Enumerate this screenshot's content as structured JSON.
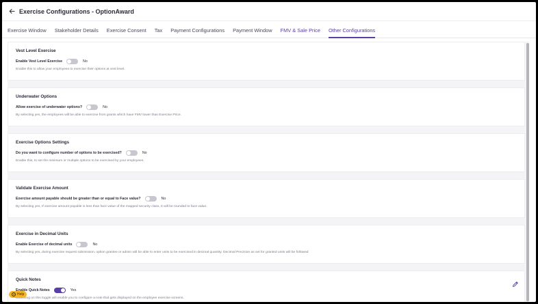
{
  "header": {
    "title": "Exercise Configurations - OptionAward"
  },
  "tabs": [
    {
      "label": "Exercise Window"
    },
    {
      "label": "Stakeholder Details"
    },
    {
      "label": "Exercise Consent"
    },
    {
      "label": "Tax"
    },
    {
      "label": "Payment Configurations"
    },
    {
      "label": "Payment Window"
    },
    {
      "label": "FMV & Sale Price"
    },
    {
      "label": "Other Configurations"
    }
  ],
  "active_tab": "Other Configurations",
  "sections": [
    {
      "title": "Vest Level Exercise",
      "label": "Enable Vest Level Exercise",
      "state": "No",
      "description": "Enable this to allow your employees to exercise their options at vest level."
    },
    {
      "title": "Underwater Options",
      "label": "Allow exercise of underwater options?",
      "state": "No",
      "description": "By selecting yes, the employees will be able to exercise from grants which have FMV lower than Exercise Price."
    },
    {
      "title": "Exercise Options Settings",
      "label": "Do you want to configure number of options to be exercised?",
      "state": "No",
      "description": "Enable this, to set the minimum or multiple options to be exercised by your employees."
    },
    {
      "title": "Validate Exercise Amount",
      "label": "Exercise amount payable should be greater than or equal to Face value?",
      "state": "No",
      "description": "By selecting yes, If exercise amount payable is less than face value of the mapped security class, It will be rounded to face value."
    },
    {
      "title": "Exercise in Decimal Units",
      "label": "Enable Exercise of decimal units",
      "state": "No",
      "description": "By selecting yes, during exercise request submission, option grantee or admin will be able to enter units to be exercised in decimal quantity. Decimal Precision as set for granted units will be followed"
    },
    {
      "title": "Quick Notes",
      "label": "Enable Quick Notes",
      "state": "Yes",
      "description": "Switching on this toggle will enable you to configure a note that gets displayed on the employee exercise screens."
    }
  ],
  "help": {
    "label": "Help"
  },
  "colors": {
    "accent": "#5a3ea8",
    "help": "#f4b625"
  },
  "icons": {
    "back": "arrow-left-icon",
    "edit": "pencil-icon",
    "help": "question-circle-icon"
  }
}
